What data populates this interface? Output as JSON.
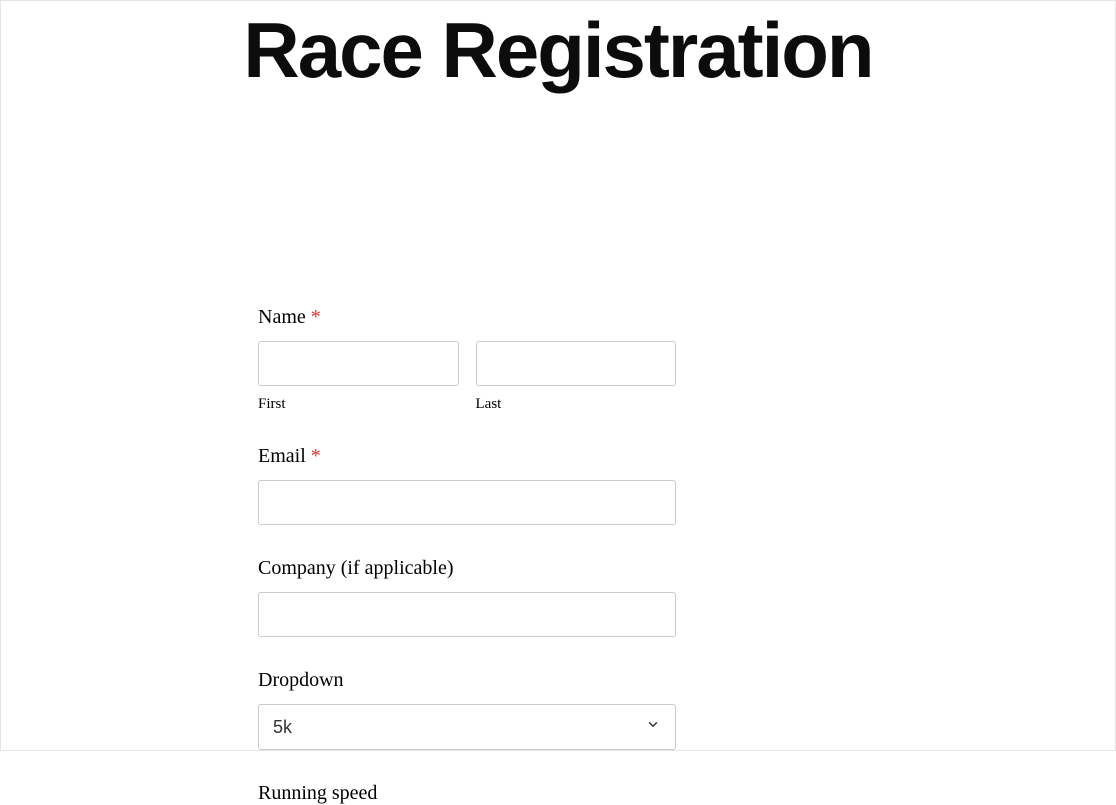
{
  "page": {
    "title": "Race Registration"
  },
  "form": {
    "name": {
      "label": "Name",
      "required_mark": "*",
      "first_sublabel": "First",
      "last_sublabel": "Last",
      "first_value": "",
      "last_value": ""
    },
    "email": {
      "label": "Email",
      "required_mark": "*",
      "value": ""
    },
    "company": {
      "label": "Company (if applicable)",
      "value": ""
    },
    "dropdown": {
      "label": "Dropdown",
      "selected": "5k"
    },
    "running_speed": {
      "label": "Running speed"
    }
  }
}
